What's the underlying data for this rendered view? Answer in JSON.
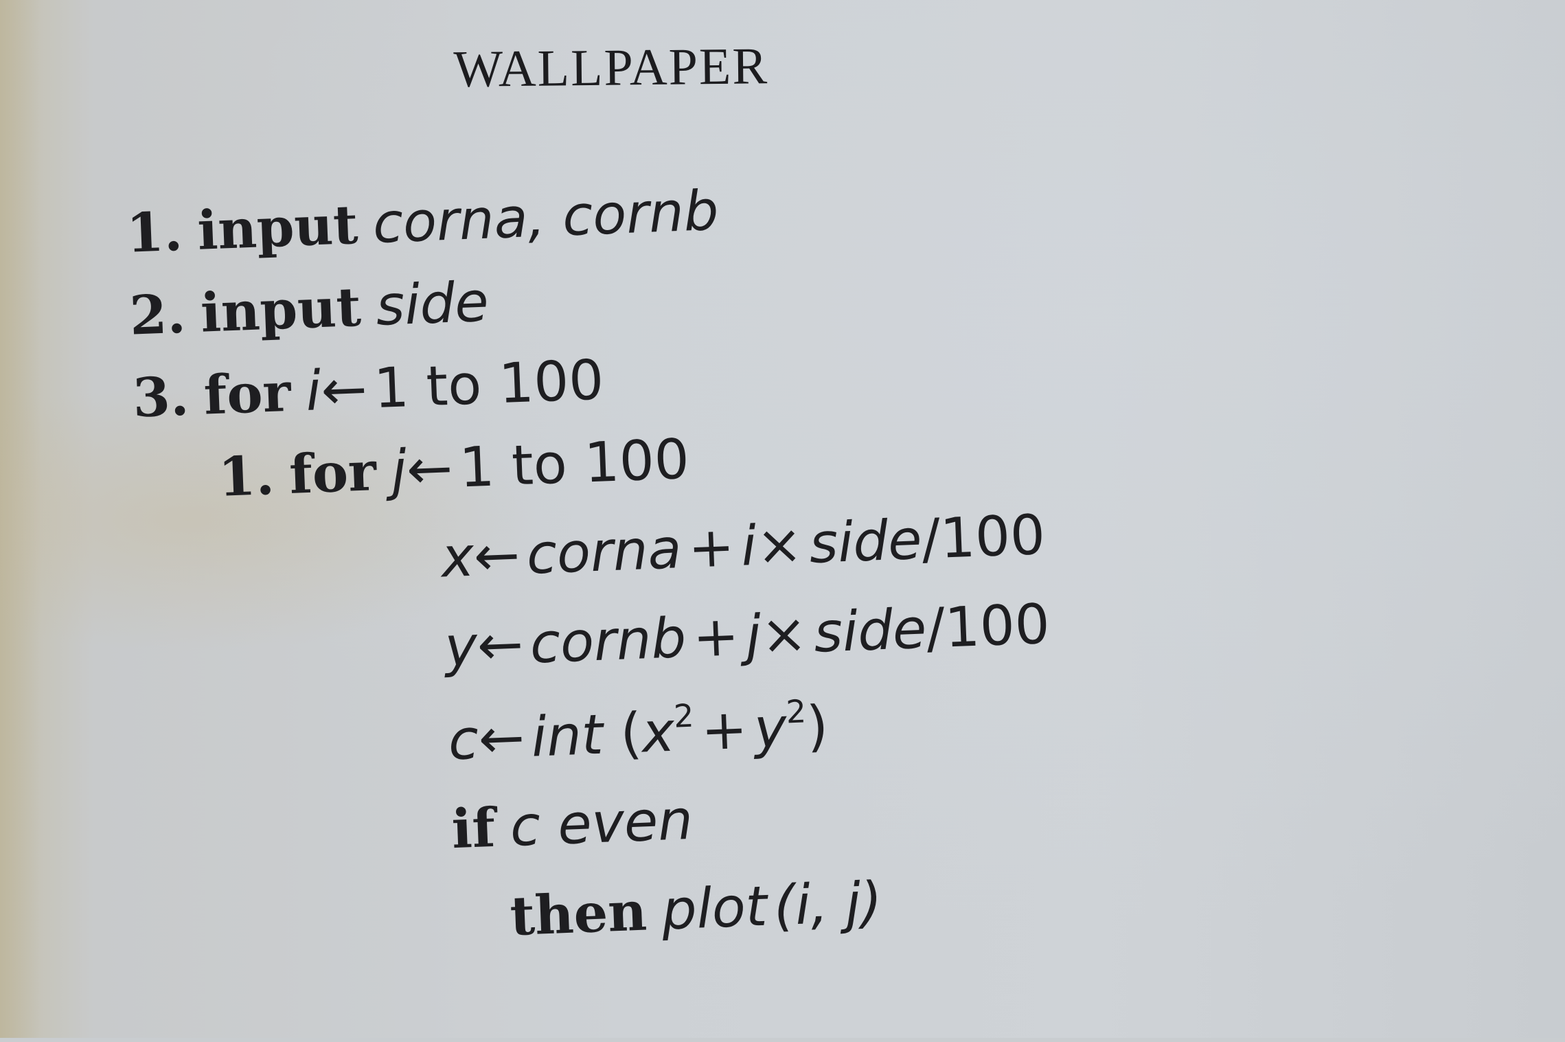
{
  "title": "WALLPAPER",
  "algorithm": [
    {
      "num": "1.",
      "kw": "input",
      "arg": "corna, cornb"
    },
    {
      "num": "2.",
      "kw": "input",
      "arg": "side"
    },
    {
      "num": "3.",
      "kw": "for",
      "var": "i",
      "arrow": "←",
      "range": "1 to 100"
    },
    {
      "num": "1.",
      "kw": "for",
      "var": "j",
      "arrow": "←",
      "range": "1 to 100"
    },
    {
      "lhs": "x",
      "arrow": "←",
      "a": "corna",
      "plus": "+",
      "b": "i",
      "times": "×",
      "c": "side",
      "div": "/100"
    },
    {
      "lhs": "y",
      "arrow": "←",
      "a": "cornb",
      "plus": "+",
      "b": "j",
      "times": "×",
      "c": "side",
      "div": "/100"
    },
    {
      "lhs": "c",
      "arrow": "←",
      "fn": "int",
      "open": " (",
      "v1": "x",
      "sq1": "2",
      "plus": "+",
      "v2": "y",
      "sq2": "2",
      "close": ")"
    },
    {
      "kw": "if",
      "cond": "c even"
    },
    {
      "kw": "then",
      "call": "plot",
      "args": "(i, j)"
    }
  ]
}
